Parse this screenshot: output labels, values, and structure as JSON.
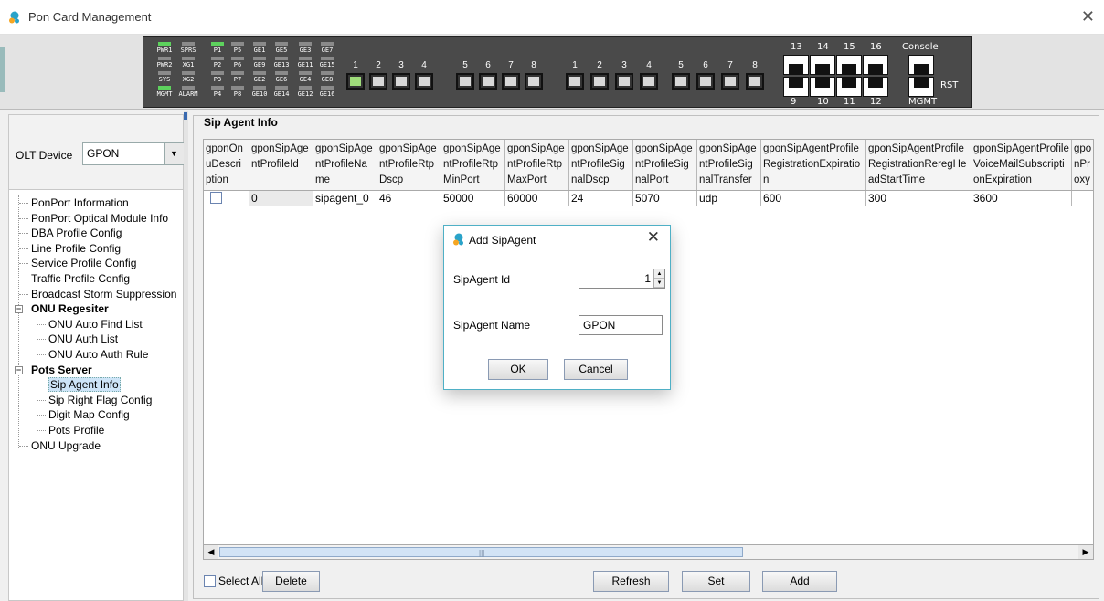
{
  "window": {
    "title": "Pon Card Management",
    "close_glyph": "✕"
  },
  "device_panel": {
    "leds": [
      {
        "label": "PWR1",
        "on": true
      },
      {
        "label": "SPRS",
        "on": false
      },
      {
        "label": "PWR2",
        "on": false
      },
      {
        "label": "XG1",
        "on": false
      },
      {
        "label": "SYS",
        "on": false
      },
      {
        "label": "XG2",
        "on": false
      },
      {
        "label": "MGMT",
        "on": true
      },
      {
        "label": "ALARM",
        "on": false
      },
      {
        "label": "P1",
        "on": true
      },
      {
        "label": "P5",
        "on": false
      },
      {
        "label": "P2",
        "on": false
      },
      {
        "label": "P6",
        "on": false
      },
      {
        "label": "P3",
        "on": false
      },
      {
        "label": "P7",
        "on": false
      },
      {
        "label": "P4",
        "on": false
      },
      {
        "label": "P8",
        "on": false
      },
      {
        "label": "GE1",
        "on": false
      },
      {
        "label": "GE5",
        "on": false
      },
      {
        "label": "GE9",
        "on": false
      },
      {
        "label": "GE13",
        "on": false
      },
      {
        "label": "GE2",
        "on": false
      },
      {
        "label": "GE6",
        "on": false
      },
      {
        "label": "GE10",
        "on": false
      },
      {
        "label": "GE14",
        "on": false
      },
      {
        "label": "GE3",
        "on": false
      },
      {
        "label": "GE7",
        "on": false
      },
      {
        "label": "GE11",
        "on": false
      },
      {
        "label": "GE15",
        "on": false
      },
      {
        "label": "GE4",
        "on": false
      },
      {
        "label": "GE8",
        "on": false
      },
      {
        "label": "GE12",
        "on": false
      },
      {
        "label": "GE16",
        "on": false
      }
    ],
    "pon_ports": [
      "1",
      "2",
      "3",
      "4",
      "5",
      "6",
      "7",
      "8"
    ],
    "pon_active": [
      true,
      false,
      false,
      false,
      false,
      false,
      false,
      false
    ],
    "ge_ports": [
      "1",
      "2",
      "3",
      "4",
      "5",
      "6",
      "7",
      "8"
    ],
    "rj_top_labels": [
      "13",
      "14",
      "15",
      "16"
    ],
    "rj_bottom_labels": [
      "9",
      "10",
      "11",
      "12"
    ],
    "console_label": "Console",
    "mgmt_label": "MGMT",
    "rst_label": "RST"
  },
  "olt": {
    "label": "OLT Device",
    "value": "GPON",
    "arrow": "▼"
  },
  "tree": [
    {
      "label": "PonPort Information",
      "level": 1
    },
    {
      "label": "PonPort Optical Module Info",
      "level": 1
    },
    {
      "label": "DBA Profile Config",
      "level": 1
    },
    {
      "label": "Line Profile Config",
      "level": 1
    },
    {
      "label": "Service Profile Config",
      "level": 1
    },
    {
      "label": "Traffic Profile Config",
      "level": 1
    },
    {
      "label": "Broadcast Storm Suppression",
      "level": 1
    },
    {
      "label": "ONU Regesiter",
      "level": 0,
      "toggle": "−"
    },
    {
      "label": "ONU Auto Find List",
      "level": 2
    },
    {
      "label": "ONU Auth List",
      "level": 2
    },
    {
      "label": "ONU Auto Auth Rule",
      "level": 2
    },
    {
      "label": "Pots Server",
      "level": 0,
      "toggle": "−"
    },
    {
      "label": "Sip Agent Info",
      "level": 2,
      "selected": true
    },
    {
      "label": "Sip Right Flag Config",
      "level": 2
    },
    {
      "label": "Digit Map Config",
      "level": 2
    },
    {
      "label": "Pots Profile",
      "level": 2
    },
    {
      "label": "ONU Upgrade",
      "level": 1
    }
  ],
  "section": {
    "title": "Sip Agent Info"
  },
  "table": {
    "columns": [
      "gponOnuDescription",
      "gponSipAgentProfileId",
      "gponSipAgentProfileName",
      "gponSipAgentProfileRtpDscp",
      "gponSipAgentProfileRtpMinPort",
      "gponSipAgentProfileRtpMaxPort",
      "gponSipAgentProfileSignalDscp",
      "gponSipAgentProfileSignalPort",
      "gponSipAgentProfileSignalTransferMode",
      "gponSipAgentProfileRegistrationExpiration",
      "gponSipAgentProfileRegistrationReregHeadStartTime",
      "gponSipAgentProfileVoiceMailSubscriptionExpiration",
      "gponProxy"
    ],
    "rows": [
      [
        "",
        "0",
        "sipagent_0",
        "46",
        "50000",
        "60000",
        "24",
        "5070",
        "udp",
        "600",
        "300",
        "3600",
        ""
      ]
    ]
  },
  "scroll": {
    "left": "◀",
    "right": "▶",
    "grip": "|||"
  },
  "actions": {
    "select_all": "Select All",
    "delete": "Delete",
    "refresh": "Refresh",
    "set": "Set",
    "add": "Add"
  },
  "dialog": {
    "title": "Add SipAgent",
    "close": "✕",
    "id_label": "SipAgent Id",
    "id_value": "1",
    "name_label": "SipAgent Name",
    "name_value": "GPON",
    "ok": "OK",
    "cancel": "Cancel",
    "spin_up": "▲",
    "spin_down": "▼"
  }
}
